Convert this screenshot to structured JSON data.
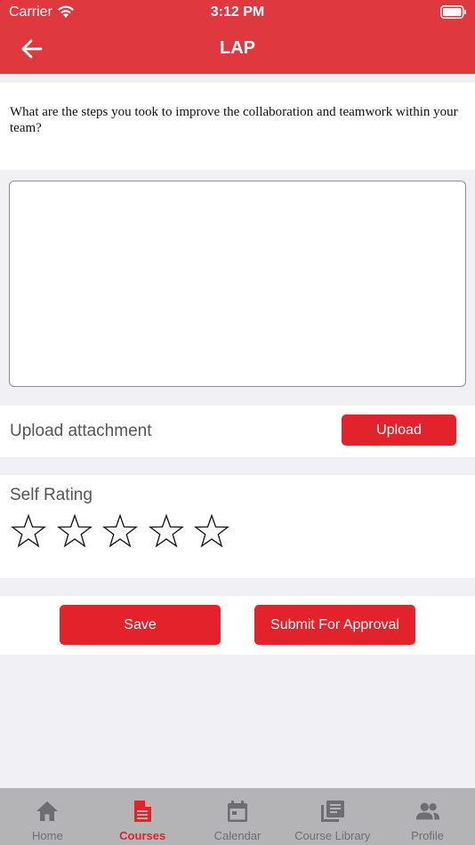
{
  "status_bar": {
    "carrier": "Carrier",
    "time": "3:12 PM"
  },
  "nav": {
    "title": "LAP",
    "back_icon": "arrow-left-icon"
  },
  "question": {
    "text": "What are the steps you took to improve the collaboration and teamwork within your team?"
  },
  "answer": {
    "value": "",
    "placeholder": ""
  },
  "upload": {
    "label": "Upload attachment",
    "button_label": "Upload"
  },
  "rating": {
    "label": "Self Rating",
    "max_stars": 5,
    "value": 0
  },
  "actions": {
    "save_label": "Save",
    "submit_label": "Submit For Approval"
  },
  "tabs": [
    {
      "label": "Home",
      "icon": "home-icon",
      "active": false
    },
    {
      "label": "Courses",
      "icon": "document-icon",
      "active": true
    },
    {
      "label": "Calendar",
      "icon": "calendar-icon",
      "active": false
    },
    {
      "label": "Course Library",
      "icon": "library-icon",
      "active": false
    },
    {
      "label": "Profile",
      "icon": "people-icon",
      "active": false
    }
  ],
  "colors": {
    "header": "#e0383f",
    "accent": "#e3222b",
    "tabbar": "#b4b4b6",
    "background": "#f1f1f5"
  }
}
